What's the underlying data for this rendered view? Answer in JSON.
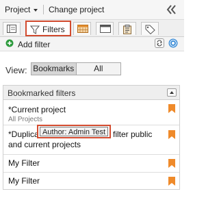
{
  "topbar": {
    "project_menu_label": "Project",
    "change_project_label": "Change project"
  },
  "tabs": {
    "filters_label": "Filters"
  },
  "add_filter": {
    "label": "Add filter"
  },
  "view": {
    "label": "View:",
    "options": [
      "Bookmarks",
      "All"
    ],
    "selected": "Bookmarks"
  },
  "bookmarked": {
    "title": "Bookmarked filters",
    "items": [
      {
        "name": "*Current project",
        "subtitle": "All Projects"
      },
      {
        "name_line1": "*Duplica",
        "name_line1_tail": "filter public",
        "name_line2": "and current projects"
      },
      {
        "name": "My Filter"
      },
      {
        "name": "My Filter"
      }
    ]
  },
  "tooltip": {
    "text": "Author: Admin Test"
  },
  "colors": {
    "highlight_border": "#d24b2f",
    "bookmark": "#ef8a2a",
    "add_icon": "#2e9b3e",
    "help_icon": "#3f8fd8"
  }
}
